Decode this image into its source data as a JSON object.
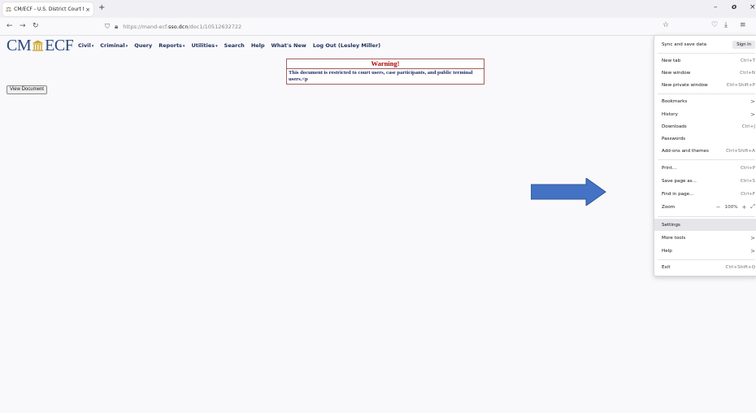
{
  "browser": {
    "tab_title": "CM/ECF - U.S. District Court fo",
    "tab_close": "×",
    "new_tab": "+",
    "url_prefix": "https://mand-ecf.",
    "url_host": "sso.dcn",
    "url_path": "/doc1/10512632722",
    "win_min": "–",
    "win_max": "o",
    "win_close": "×"
  },
  "ecf": {
    "logo_left": "CM",
    "logo_right": "ECF",
    "menu": [
      {
        "label": "Civil",
        "caret": "▾"
      },
      {
        "label": "Criminal",
        "caret": "▾"
      },
      {
        "label": "Query",
        "caret": ""
      },
      {
        "label": "Reports",
        "caret": "▾"
      },
      {
        "label": "Utilities",
        "caret": "▾"
      },
      {
        "label": "Search",
        "caret": ""
      },
      {
        "label": "Help",
        "caret": ""
      },
      {
        "label": "What's New",
        "caret": ""
      },
      {
        "label": "Log Out (Lesley Miller)",
        "caret": ""
      }
    ]
  },
  "warning": {
    "title": "Warning!",
    "body": "This document is restricted to court users, case participants, and public terminal users.<p"
  },
  "view_document_label": "View Document",
  "app_menu": {
    "sync": "Sync and save data",
    "sign_in": "Sign In",
    "new_tab": "New tab",
    "new_tab_sc": "Ctrl+T",
    "new_window": "New window",
    "new_window_sc": "Ctrl+N",
    "new_private": "New private window",
    "new_private_sc": "Ctrl+Shift+P",
    "bookmarks": "Bookmarks",
    "history": "History",
    "downloads": "Downloads",
    "downloads_sc": "Ctrl+J",
    "passwords": "Passwords",
    "addons": "Add-ons and themes",
    "addons_sc": "Ctrl+Shift+A",
    "print": "Print...",
    "print_sc": "Ctrl+P",
    "save_page": "Save page as...",
    "save_page_sc": "Ctrl+S",
    "find": "Find in page...",
    "find_sc": "Ctrl+F",
    "zoom": "Zoom",
    "zoom_level": "100%",
    "zoom_minus": "−",
    "zoom_plus": "+",
    "settings": "Settings",
    "more_tools": "More tools",
    "help": "Help",
    "exit": "Exit",
    "exit_sc": "Ctrl+Shift+Q",
    "chevron": ">"
  },
  "colors": {
    "arrow": "#4472c4",
    "logo": "#2e4a7c",
    "warning_title": "#b00000"
  }
}
